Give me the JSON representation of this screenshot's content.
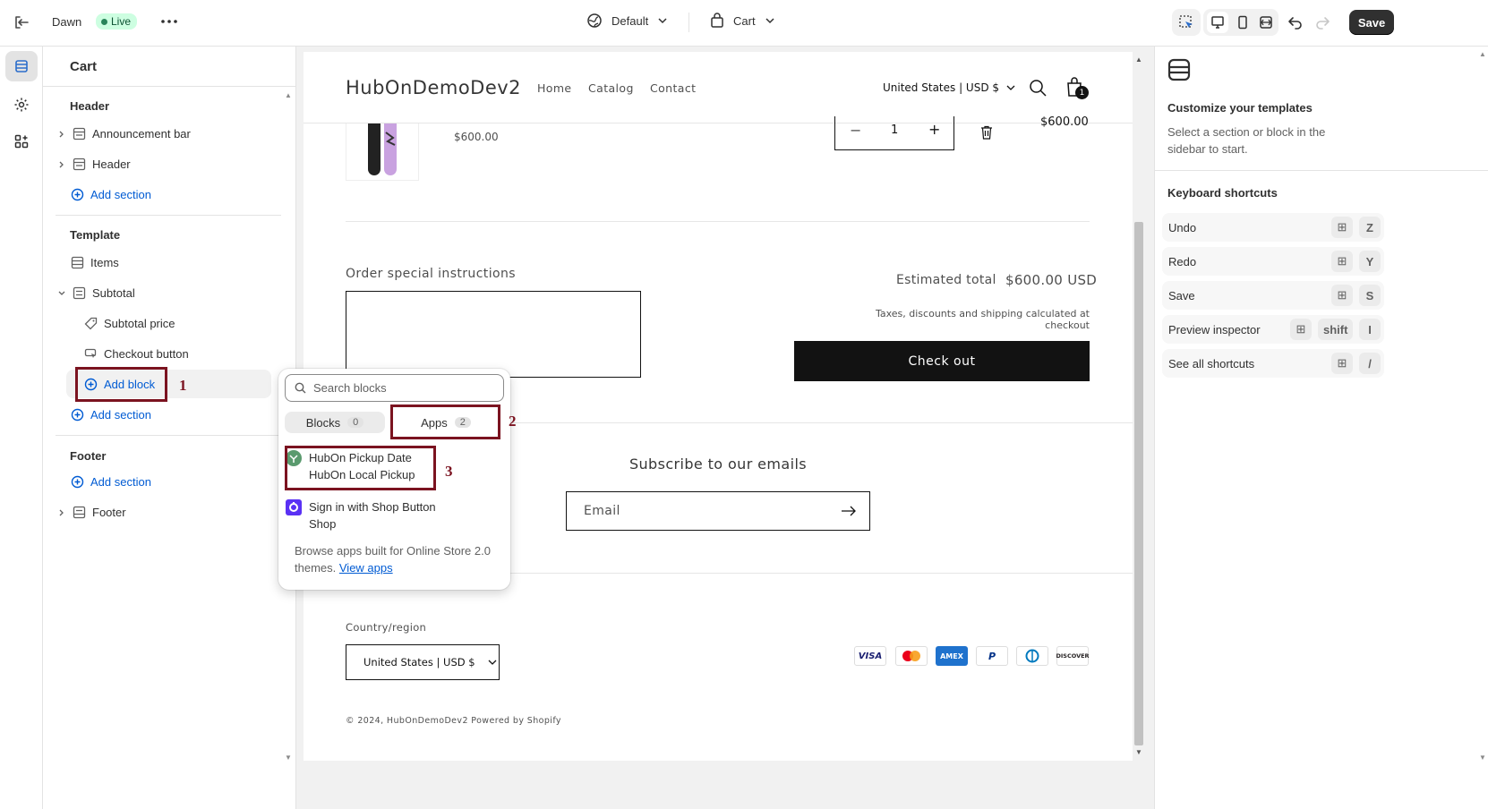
{
  "topbar": {
    "theme_name": "Dawn",
    "live_label": "Live",
    "preset_label": "Default",
    "template_label": "Cart",
    "save_label": "Save"
  },
  "sidebar": {
    "title": "Cart",
    "header_group": "Header",
    "header_items": [
      "Announcement bar",
      "Header"
    ],
    "add_section": "Add section",
    "template_group": "Template",
    "template_items": {
      "items": "Items",
      "subtotal": "Subtotal",
      "subtotal_price": "Subtotal price",
      "checkout_button": "Checkout button",
      "add_block": "Add block"
    },
    "footer_group": "Footer",
    "footer_items": [
      "Footer"
    ]
  },
  "popover": {
    "search_placeholder": "Search blocks",
    "tabs": [
      {
        "label": "Blocks",
        "count": "0"
      },
      {
        "label": "Apps",
        "count": "2"
      }
    ],
    "apps": [
      {
        "title": "HubOn Pickup Date",
        "subtitle": "HubOn Local Pickup"
      },
      {
        "title": "Sign in with Shop Button",
        "subtitle": "Shop"
      }
    ],
    "browse_text": "Browse apps built for Online Store 2.0 themes.",
    "browse_link": "View apps"
  },
  "annotations": [
    "1",
    "2",
    "3"
  ],
  "store": {
    "name": "HubOnDemoDev2",
    "nav": [
      "Home",
      "Catalog",
      "Contact"
    ],
    "currency": "United States | USD $",
    "cart_count": "1",
    "item_price": "$600.00",
    "line_total": "$600.00",
    "quantity": "1",
    "instructions_label": "Order special instructions",
    "estimated_total_label": "Estimated total",
    "estimated_total_value": "$600.00 USD",
    "tax_note": "Taxes, discounts and shipping calculated at checkout",
    "checkout_label": "Check out",
    "subscribe_title": "Subscribe to our emails",
    "email_placeholder": "Email",
    "country_label": "Country/region",
    "country_value": "United States | USD $",
    "payment_methods": [
      "VISA",
      "Mastercard",
      "AMEX",
      "PayPal",
      "Diners",
      "DISCOVER"
    ],
    "copyright": "© 2024, HubOnDemoDev2 Powered by Shopify"
  },
  "right_panel": {
    "title": "Customize your templates",
    "description": "Select a section or block in the sidebar to start.",
    "shortcuts_title": "Keyboard shortcuts",
    "shortcuts": [
      {
        "label": "Undo",
        "keys": [
          "⊞",
          "Z"
        ]
      },
      {
        "label": "Redo",
        "keys": [
          "⊞",
          "Y"
        ]
      },
      {
        "label": "Save",
        "keys": [
          "⊞",
          "S"
        ]
      },
      {
        "label": "Preview inspector",
        "keys": [
          "⊞",
          "shift",
          "I"
        ]
      },
      {
        "label": "See all shortcuts",
        "keys": [
          "⊞",
          "/"
        ]
      }
    ]
  }
}
